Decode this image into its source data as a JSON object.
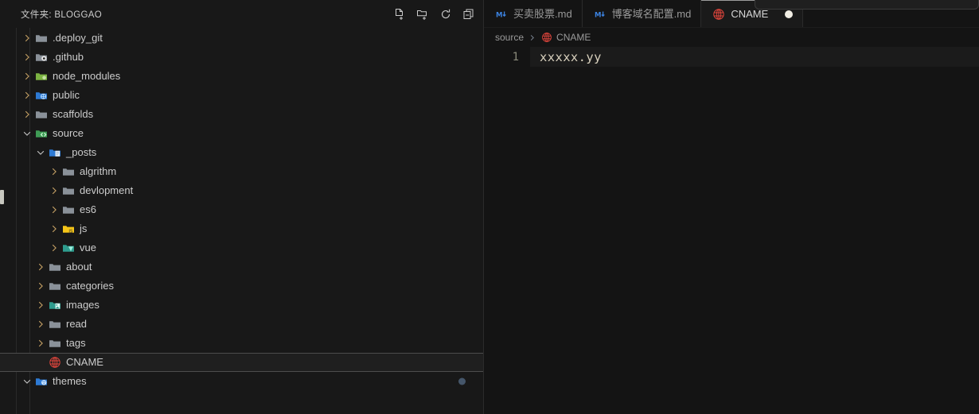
{
  "sidebar": {
    "title": "文件夹: BLOGGAO",
    "actions": [
      {
        "name": "new-file-icon",
        "tooltip": "新建文件"
      },
      {
        "name": "new-folder-icon",
        "tooltip": "新建文件夹"
      },
      {
        "name": "refresh-icon",
        "tooltip": "刷新资源管理器"
      },
      {
        "name": "collapse-all-icon",
        "tooltip": "在资源管理器中折叠文件夹"
      }
    ],
    "tree": [
      {
        "label": ".deploy_git",
        "indent": 0,
        "twisty": "collapsed",
        "icon": "folder-plain",
        "selected": false,
        "badge": false
      },
      {
        "label": ".github",
        "indent": 0,
        "twisty": "collapsed",
        "icon": "folder-github",
        "selected": false,
        "badge": false
      },
      {
        "label": "node_modules",
        "indent": 0,
        "twisty": "collapsed",
        "icon": "folder-node",
        "selected": false,
        "badge": false
      },
      {
        "label": "public",
        "indent": 0,
        "twisty": "collapsed",
        "icon": "folder-public",
        "selected": false,
        "badge": false
      },
      {
        "label": "scaffolds",
        "indent": 0,
        "twisty": "collapsed",
        "icon": "folder-plain",
        "selected": false,
        "badge": false
      },
      {
        "label": "source",
        "indent": 0,
        "twisty": "expanded",
        "icon": "folder-src",
        "selected": false,
        "badge": false
      },
      {
        "label": "_posts",
        "indent": 1,
        "twisty": "expanded",
        "icon": "folder-posts",
        "selected": false,
        "badge": false
      },
      {
        "label": "algrithm",
        "indent": 2,
        "twisty": "collapsed",
        "icon": "folder-plain",
        "selected": false,
        "badge": false
      },
      {
        "label": "devlopment",
        "indent": 2,
        "twisty": "collapsed",
        "icon": "folder-plain",
        "selected": false,
        "badge": false
      },
      {
        "label": "es6",
        "indent": 2,
        "twisty": "collapsed",
        "icon": "folder-plain",
        "selected": false,
        "badge": false
      },
      {
        "label": "js",
        "indent": 2,
        "twisty": "collapsed",
        "icon": "folder-js",
        "selected": false,
        "badge": false
      },
      {
        "label": "vue",
        "indent": 2,
        "twisty": "collapsed",
        "icon": "folder-vue",
        "selected": false,
        "badge": false
      },
      {
        "label": "about",
        "indent": 1,
        "twisty": "collapsed",
        "icon": "folder-plain",
        "selected": false,
        "badge": false
      },
      {
        "label": "categories",
        "indent": 1,
        "twisty": "collapsed",
        "icon": "folder-plain",
        "selected": false,
        "badge": false
      },
      {
        "label": "images",
        "indent": 1,
        "twisty": "collapsed",
        "icon": "folder-images",
        "selected": false,
        "badge": false
      },
      {
        "label": "read",
        "indent": 1,
        "twisty": "collapsed",
        "icon": "folder-plain",
        "selected": false,
        "badge": false
      },
      {
        "label": "tags",
        "indent": 1,
        "twisty": "collapsed",
        "icon": "folder-plain",
        "selected": false,
        "badge": false
      },
      {
        "label": "CNAME",
        "indent": 1,
        "twisty": "none",
        "icon": "globe",
        "selected": true,
        "badge": false
      },
      {
        "label": "themes",
        "indent": 0,
        "twisty": "expanded",
        "icon": "folder-themes",
        "selected": false,
        "badge": true
      }
    ]
  },
  "tabs": [
    {
      "label": "买卖股票.md",
      "icon": "markdown-icon",
      "active": false,
      "dirty": false
    },
    {
      "label": "博客域名配置.md",
      "icon": "markdown-icon",
      "active": false,
      "dirty": false
    },
    {
      "label": "CNAME",
      "icon": "globe-icon",
      "active": true,
      "dirty": true
    }
  ],
  "breadcrumb": {
    "folder": "source",
    "file": "CNAME"
  },
  "editor": {
    "lines": [
      {
        "number": "1",
        "text": "xxxxx.yy"
      }
    ]
  },
  "colors": {
    "editor_bg": "#141414",
    "sidebar_bg": "#181818",
    "accent_red": "#e0453c",
    "text": "#cccccc",
    "code_text": "#d8d0bd",
    "badge": "#45566a"
  }
}
